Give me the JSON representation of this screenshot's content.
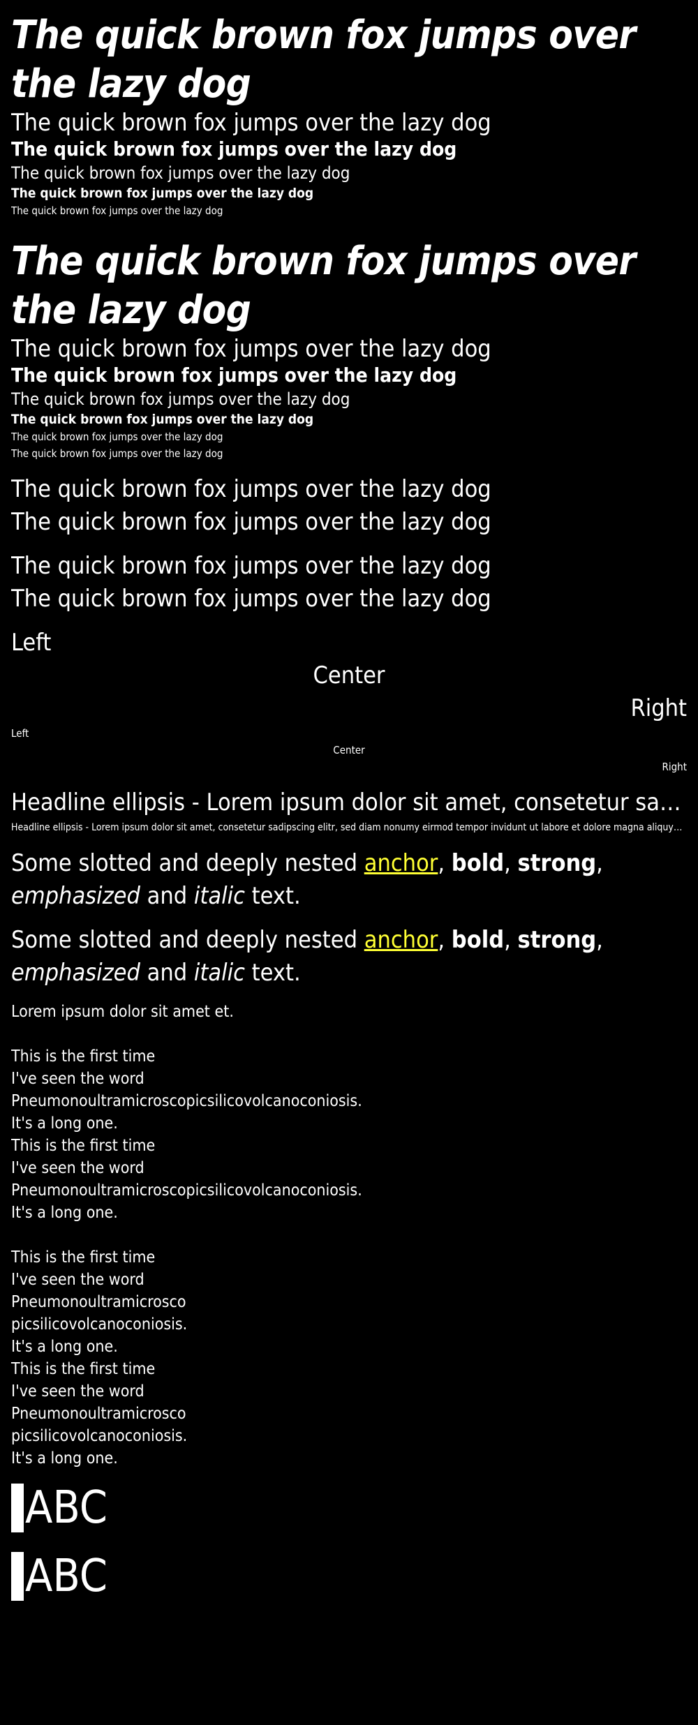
{
  "pangram": "The quick brown fox jumps over the lazy dog",
  "alignment": {
    "left": "Left",
    "center": "Center",
    "right": "Right"
  },
  "ellipsis_text": "Headline ellipsis - Lorem ipsum dolor sit amet, consetetur sadipscing elitr, sed diam nonumy eirmod tempor invidunt ut labore et dolore magna aliquyam erat",
  "rich": {
    "part1": "Some slotted and deeply nested ",
    "anchor": "anchor",
    "comma1": ", ",
    "bold": "bold",
    "comma2": ", ",
    "strong": "strong",
    "comma3": ", ",
    "emphasized": "emphasized",
    "and": " and ",
    "italic": "italic",
    "end": " text."
  },
  "lorem_short": "Lorem ipsum dolor sit amet et.",
  "long_word": {
    "line1": "This is the first time",
    "line2": "I've seen the word",
    "word": "Pneumonoultramicroscopicsilicovolcanoconiosis.",
    "line4": "It's a long one."
  },
  "long_word_narrow": {
    "line1": "This is the first time",
    "line2": "I've seen the word",
    "text": "Pneumonoultramicroscopicsilicovolcanoconiosis. It's a long one."
  },
  "abc": "ABC",
  "colors": {
    "background": "#000000",
    "text": "#ffffff",
    "link": "#ffff33"
  }
}
